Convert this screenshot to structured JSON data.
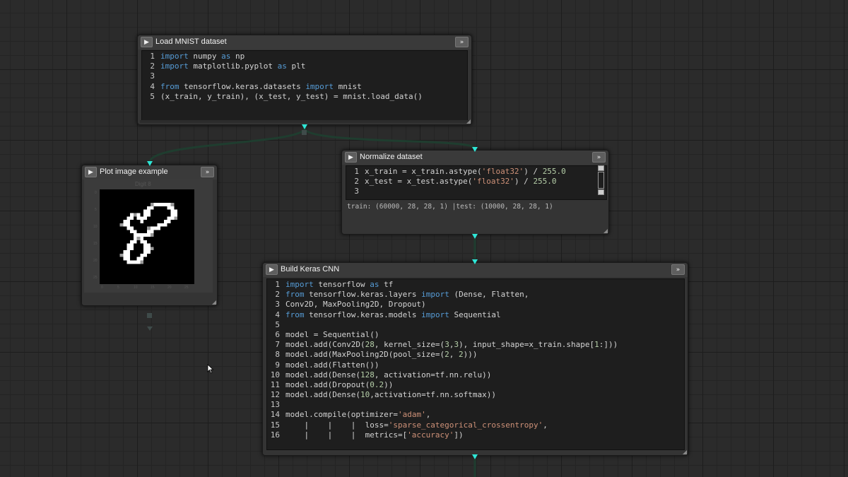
{
  "colors": {
    "canvas_bg": "#2b2b2b",
    "node_bg": "#343434",
    "editor_bg": "#1e1e1e",
    "wire": "#1f3d2f",
    "port": "#2ee6d6",
    "keyword": "#569cd6",
    "string": "#ce9178",
    "number": "#b5cea8"
  },
  "icons": {
    "collapse": "▶",
    "expand": "»",
    "collapse_icon_name": "chevron-right-icon",
    "expand_icon_name": "double-chevron-right-icon"
  },
  "nodes": {
    "load_mnist": {
      "title": "Load MNIST dataset",
      "code": [
        [
          [
            "kw",
            "import"
          ],
          [
            "t",
            " numpy "
          ],
          [
            "kw",
            "as"
          ],
          [
            "t",
            " np"
          ]
        ],
        [
          [
            "kw",
            "import"
          ],
          [
            "t",
            " matplotlib.pyplot "
          ],
          [
            "kw",
            "as"
          ],
          [
            "t",
            " plt"
          ]
        ],
        [],
        [
          [
            "kw",
            "from"
          ],
          [
            "t",
            " tensorflow.keras.datasets "
          ],
          [
            "kw",
            "import"
          ],
          [
            "t",
            " mnist"
          ]
        ],
        [
          [
            "t",
            "(x_train, y_train), (x_test, y_test) = mnist.load_data()"
          ]
        ]
      ]
    },
    "plot_image": {
      "title": "Plot image example",
      "plot_title": "Digit 8",
      "y_ticks": [
        "0",
        "5",
        "10",
        "15",
        "20",
        "25"
      ],
      "x_ticks": [
        "0",
        "5",
        "10",
        "15",
        "20",
        "25"
      ]
    },
    "normalize": {
      "title": "Normalize dataset",
      "code": [
        [
          [
            "t",
            "x_train = x_train.astype("
          ],
          [
            "str",
            "'float32'"
          ],
          [
            "t",
            ") / "
          ],
          [
            "num",
            "255.0"
          ]
        ],
        [
          [
            "t",
            "x_test = x_test.astype("
          ],
          [
            "str",
            "'float32'"
          ],
          [
            "t",
            ") / "
          ],
          [
            "num",
            "255.0"
          ]
        ],
        []
      ],
      "output": "train: (60000, 28, 28, 1) |test: (10000, 28, 28, 1)"
    },
    "build_cnn": {
      "title": "Build Keras CNN",
      "code": [
        [
          [
            "kw",
            "import"
          ],
          [
            "t",
            " tensorflow "
          ],
          [
            "kw",
            "as"
          ],
          [
            "t",
            " tf"
          ]
        ],
        [
          [
            "kw",
            "from"
          ],
          [
            "t",
            " tensorflow.keras.layers "
          ],
          [
            "kw",
            "import"
          ],
          [
            "t",
            " (Dense, Flatten,"
          ]
        ],
        [
          [
            "t",
            "Conv2D, MaxPooling2D, Dropout)"
          ]
        ],
        [
          [
            "kw",
            "from"
          ],
          [
            "t",
            " tensorflow.keras.models "
          ],
          [
            "kw",
            "import"
          ],
          [
            "t",
            " Sequential"
          ]
        ],
        [],
        [
          [
            "t",
            "model = Sequential()"
          ]
        ],
        [
          [
            "t",
            "model.add(Conv2D("
          ],
          [
            "num",
            "28"
          ],
          [
            "t",
            ", kernel_size=("
          ],
          [
            "num",
            "3"
          ],
          [
            "t",
            ","
          ],
          [
            "num",
            "3"
          ],
          [
            "t",
            "), input_shape=x_train.shape["
          ],
          [
            "num",
            "1"
          ],
          [
            "t",
            ":]))"
          ]
        ],
        [
          [
            "t",
            "model.add(MaxPooling2D(pool_size=("
          ],
          [
            "num",
            "2"
          ],
          [
            "t",
            ", "
          ],
          [
            "num",
            "2"
          ],
          [
            "t",
            ")))"
          ]
        ],
        [
          [
            "t",
            "model.add(Flatten())"
          ]
        ],
        [
          [
            "t",
            "model.add(Dense("
          ],
          [
            "num",
            "128"
          ],
          [
            "t",
            ", activation=tf.nn.relu))"
          ]
        ],
        [
          [
            "t",
            "model.add(Dropout("
          ],
          [
            "num",
            "0.2"
          ],
          [
            "t",
            "))"
          ]
        ],
        [
          [
            "t",
            "model.add(Dense("
          ],
          [
            "num",
            "10"
          ],
          [
            "t",
            ",activation=tf.nn.softmax))"
          ]
        ],
        [],
        [
          [
            "t",
            "model.compile(optimizer="
          ],
          [
            "str",
            "'adam'"
          ],
          [
            "t",
            ","
          ]
        ],
        [
          [
            "t",
            "    |    |    |  loss="
          ],
          [
            "str",
            "'sparse_categorical_crossentropy'"
          ],
          [
            "t",
            ","
          ]
        ],
        [
          [
            "t",
            "    |    |    |  metrics=["
          ],
          [
            "str",
            "'accuracy'"
          ],
          [
            "t",
            "])"
          ]
        ]
      ]
    }
  }
}
